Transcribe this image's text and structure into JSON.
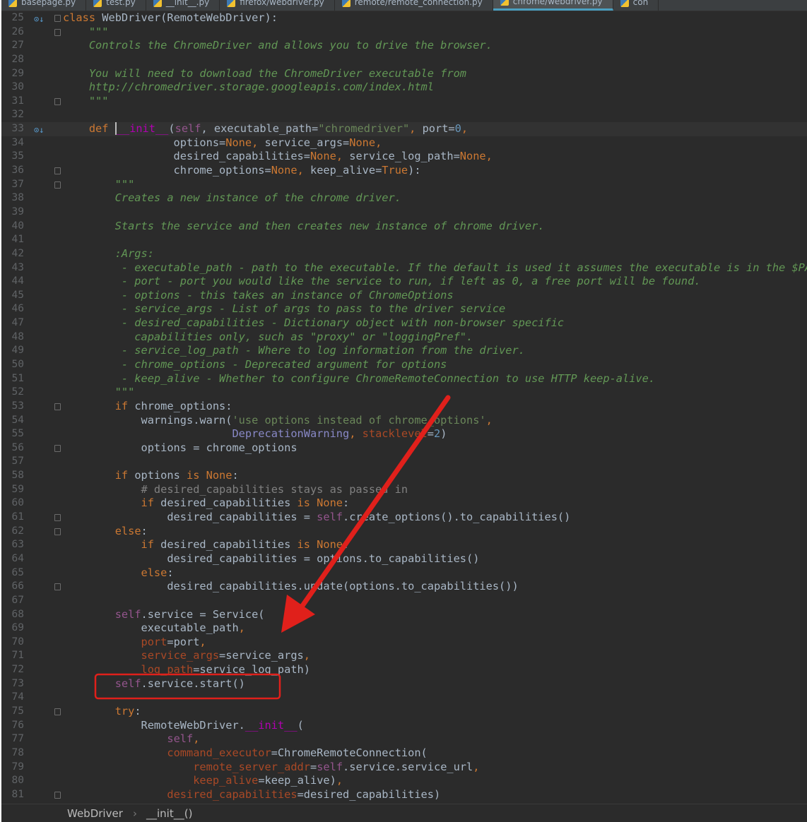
{
  "tabs": [
    {
      "label": "basepage.py",
      "active": false
    },
    {
      "label": "test.py",
      "active": false
    },
    {
      "label": "__init__.py",
      "active": false
    },
    {
      "label": "firefox/webdriver.py",
      "active": false
    },
    {
      "label": "remote/remote_connection.py",
      "active": false
    },
    {
      "label": "chrome/webdriver.py",
      "active": true
    },
    {
      "label": "con",
      "active": false
    }
  ],
  "editor": {
    "first_line": 25,
    "current_line": 33,
    "fold_lines": [
      25,
      26,
      31,
      36,
      37,
      53,
      56,
      61,
      62,
      66,
      75,
      81
    ],
    "override_lines": [
      25,
      33
    ],
    "lines": [
      [
        [
          "class",
          "kw"
        ],
        [
          " WebDriver(RemoteWebDriver):",
          ""
        ]
      ],
      [
        [
          "    \"\"\"",
          "doc"
        ]
      ],
      [
        [
          "    Controls the ChromeDriver and allows you to drive the browser.",
          "doc"
        ]
      ],
      [],
      [
        [
          "    You will need to download the ChromeDriver executable from",
          "doc"
        ]
      ],
      [
        [
          "    http://chromedriver.storage.googleapis.com/index.html",
          "doc"
        ]
      ],
      [
        [
          "    \"\"\"",
          "doc"
        ]
      ],
      [],
      [
        [
          "    ",
          ""
        ],
        [
          "def",
          "kw"
        ],
        [
          " ",
          ""
        ],
        [
          "__init__",
          "magic caret"
        ],
        [
          "(",
          ""
        ],
        [
          "self",
          "self"
        ],
        [
          ", executable_path=",
          ""
        ],
        [
          "\"chromedriver\"",
          "str"
        ],
        [
          ", ",
          "kw"
        ],
        [
          "port=",
          ""
        ],
        [
          "0",
          "num"
        ],
        [
          ",",
          "kw"
        ]
      ],
      [
        [
          "                 options=",
          ""
        ],
        [
          "None",
          "kw"
        ],
        [
          ", ",
          "kw"
        ],
        [
          "service_args=",
          ""
        ],
        [
          "None",
          "kw"
        ],
        [
          ",",
          "kw"
        ]
      ],
      [
        [
          "                 desired_capabilities=",
          ""
        ],
        [
          "None",
          "kw"
        ],
        [
          ", ",
          "kw"
        ],
        [
          "service_log_path=",
          ""
        ],
        [
          "None",
          "kw"
        ],
        [
          ",",
          "kw"
        ]
      ],
      [
        [
          "                 chrome_options=",
          ""
        ],
        [
          "None",
          "kw"
        ],
        [
          ", ",
          "kw"
        ],
        [
          "keep_alive=",
          ""
        ],
        [
          "True",
          "kw"
        ],
        [
          "):",
          ""
        ]
      ],
      [
        [
          "        \"\"\"",
          "doc"
        ]
      ],
      [
        [
          "        Creates a new instance of the chrome driver.",
          "doc"
        ]
      ],
      [],
      [
        [
          "        Starts the service and then creates new instance of chrome driver.",
          "doc"
        ]
      ],
      [],
      [
        [
          "        :Args:",
          "doc"
        ]
      ],
      [
        [
          "         - executable_path - path to the executable. If the default is used it assumes the executable is in the $PATH",
          "doc"
        ]
      ],
      [
        [
          "         - port - port you would like the service to run, if left as 0, a free port will be found.",
          "doc"
        ]
      ],
      [
        [
          "         - options - this takes an instance of ChromeOptions",
          "doc"
        ]
      ],
      [
        [
          "         - service_args - List of args to pass to the driver service",
          "doc"
        ]
      ],
      [
        [
          "         - desired_capabilities - Dictionary object with non-browser specific",
          "doc"
        ]
      ],
      [
        [
          "           capabilities only, such as \"proxy\" or \"loggingPref\".",
          "doc"
        ]
      ],
      [
        [
          "         - service_log_path - Where to log information from the driver.",
          "doc"
        ]
      ],
      [
        [
          "         - chrome_options - Deprecated argument for options",
          "doc"
        ]
      ],
      [
        [
          "         - keep_alive - Whether to configure ChromeRemoteConnection to use HTTP keep-alive.",
          "doc"
        ]
      ],
      [
        [
          "        \"\"\"",
          "doc"
        ]
      ],
      [
        [
          "        ",
          ""
        ],
        [
          "if",
          "kw"
        ],
        [
          " chrome_options:",
          ""
        ]
      ],
      [
        [
          "            warnings.warn(",
          ""
        ],
        [
          "'use options instead of chrome_options'",
          "str"
        ],
        [
          ",",
          "kw"
        ]
      ],
      [
        [
          "                          ",
          ""
        ],
        [
          "DeprecationWarning",
          "builtin"
        ],
        [
          ", ",
          "kw"
        ],
        [
          "stacklevel",
          "kwarg"
        ],
        [
          "=",
          ""
        ],
        [
          "2",
          "num"
        ],
        [
          ")",
          ""
        ]
      ],
      [
        [
          "            options = chrome_options",
          ""
        ]
      ],
      [],
      [
        [
          "        ",
          ""
        ],
        [
          "if",
          "kw"
        ],
        [
          " options ",
          ""
        ],
        [
          "is None",
          "kw"
        ],
        [
          ":",
          ""
        ]
      ],
      [
        [
          "            # desired_capabilities stays as passed in",
          "cmt"
        ]
      ],
      [
        [
          "            ",
          ""
        ],
        [
          "if",
          "kw"
        ],
        [
          " desired_capabilities ",
          ""
        ],
        [
          "is None",
          "kw"
        ],
        [
          ":",
          ""
        ]
      ],
      [
        [
          "                desired_capabilities = ",
          ""
        ],
        [
          "self",
          "self"
        ],
        [
          ".create_options().to_capabilities()",
          ""
        ]
      ],
      [
        [
          "        ",
          ""
        ],
        [
          "else",
          "kw"
        ],
        [
          ":",
          ""
        ]
      ],
      [
        [
          "            ",
          ""
        ],
        [
          "if",
          "kw"
        ],
        [
          " desired_capabilities ",
          ""
        ],
        [
          "is None",
          "kw"
        ],
        [
          ":",
          ""
        ]
      ],
      [
        [
          "                desired_capabilities = options.to_capabilities()",
          ""
        ]
      ],
      [
        [
          "            ",
          ""
        ],
        [
          "else",
          "kw"
        ],
        [
          ":",
          ""
        ]
      ],
      [
        [
          "                desired_capabilities.update(options.to_capabilities())",
          ""
        ]
      ],
      [],
      [
        [
          "        ",
          ""
        ],
        [
          "self",
          "self"
        ],
        [
          ".service = Service(",
          ""
        ]
      ],
      [
        [
          "            executable_path",
          ""
        ],
        [
          ",",
          "kw"
        ]
      ],
      [
        [
          "            ",
          ""
        ],
        [
          "port",
          "kwarg"
        ],
        [
          "=port",
          ""
        ],
        [
          ",",
          "kw"
        ]
      ],
      [
        [
          "            ",
          ""
        ],
        [
          "service_args",
          "kwarg"
        ],
        [
          "=service_args",
          ""
        ],
        [
          ",",
          "kw"
        ]
      ],
      [
        [
          "            ",
          ""
        ],
        [
          "log_path",
          "kwarg"
        ],
        [
          "=service_log_path)",
          ""
        ]
      ],
      [
        [
          "        ",
          ""
        ],
        [
          "self",
          "self"
        ],
        [
          ".service.start()",
          ""
        ]
      ],
      [],
      [
        [
          "        ",
          ""
        ],
        [
          "try",
          "kw"
        ],
        [
          ":",
          ""
        ]
      ],
      [
        [
          "            RemoteWebDriver.",
          ""
        ],
        [
          "__init__",
          "magic"
        ],
        [
          "(",
          ""
        ]
      ],
      [
        [
          "                ",
          ""
        ],
        [
          "self",
          "self"
        ],
        [
          ",",
          "kw"
        ]
      ],
      [
        [
          "                ",
          ""
        ],
        [
          "command_executor",
          "kwarg"
        ],
        [
          "=ChromeRemoteConnection(",
          ""
        ]
      ],
      [
        [
          "                    ",
          ""
        ],
        [
          "remote_server_addr",
          "kwarg"
        ],
        [
          "=",
          ""
        ],
        [
          "self",
          "self"
        ],
        [
          ".service.service_url",
          ""
        ],
        [
          ",",
          "kw"
        ]
      ],
      [
        [
          "                    ",
          ""
        ],
        [
          "keep_alive",
          "kwarg"
        ],
        [
          "=keep_alive)",
          ""
        ],
        [
          ",",
          "kw"
        ]
      ],
      [
        [
          "                ",
          ""
        ],
        [
          "desired_capabilities",
          "kwarg"
        ],
        [
          "=desired_capabilities)",
          ""
        ]
      ]
    ]
  },
  "breadcrumb": {
    "items": [
      "WebDriver",
      "__init__()"
    ],
    "separator": "›"
  },
  "annotation": {
    "color": "#e0201b",
    "highlighted_line": 73
  },
  "colors": {
    "background": "#2b2b2b",
    "keyword": "#cc7832",
    "docstring": "#629755",
    "self": "#94558d",
    "number": "#6897bb"
  }
}
